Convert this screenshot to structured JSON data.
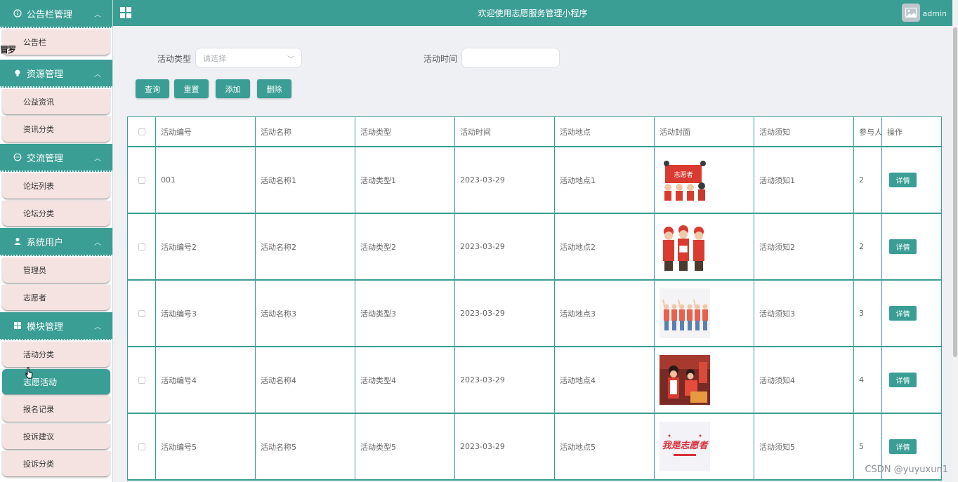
{
  "header": {
    "title": "欢迎使用志愿服务管理小程序",
    "username": "admin"
  },
  "stray_text": "冒罗",
  "sidebar": {
    "groups": [
      {
        "label": "公告栏管理",
        "icon": "info-circle-icon",
        "items": [
          {
            "label": "公告栏"
          }
        ]
      },
      {
        "label": "资源管理",
        "icon": "lightbulb-icon",
        "items": [
          {
            "label": "公益资讯"
          },
          {
            "label": "资讯分类"
          }
        ]
      },
      {
        "label": "交流管理",
        "icon": "chat-bubble-icon",
        "items": [
          {
            "label": "论坛列表"
          },
          {
            "label": "论坛分类"
          }
        ]
      },
      {
        "label": "系统用户",
        "icon": "user-icon",
        "items": [
          {
            "label": "管理员"
          },
          {
            "label": "志愿者"
          }
        ]
      },
      {
        "label": "模块管理",
        "icon": "grid-icon",
        "items": [
          {
            "label": "活动分类"
          },
          {
            "label": "志愿活动",
            "active": true
          },
          {
            "label": "报名记录"
          },
          {
            "label": "投诉建议"
          },
          {
            "label": "投诉分类"
          }
        ]
      }
    ]
  },
  "search": {
    "type_label": "活动类型",
    "type_placeholder": "请选择",
    "time_label": "活动时间",
    "time_value": ""
  },
  "buttons": {
    "query": "查询",
    "reset": "重置",
    "add": "添加",
    "delete": "删除"
  },
  "table": {
    "columns": [
      "活动编号",
      "活动名称",
      "活动类型",
      "活动时间",
      "活动地点",
      "活动封面",
      "活动须知",
      "参与人数",
      "操作"
    ],
    "detail_label": "详情",
    "rows": [
      {
        "id": "001",
        "name": "活动名称1",
        "type": "活动类型1",
        "time": "2023-03-29",
        "place": "活动地点1",
        "notice": "活动须知1",
        "count": "2"
      },
      {
        "id": "活动编号2",
        "name": "活动名称2",
        "type": "活动类型2",
        "time": "2023-03-29",
        "place": "活动地点2",
        "notice": "活动须知2",
        "count": "2"
      },
      {
        "id": "活动编号3",
        "name": "活动名称3",
        "type": "活动类型3",
        "time": "2023-03-29",
        "place": "活动地点3",
        "notice": "活动须知3",
        "count": "3"
      },
      {
        "id": "活动编号4",
        "name": "活动名称4",
        "type": "活动类型4",
        "time": "2023-03-29",
        "place": "活动地点4",
        "notice": "活动须知4",
        "count": "4"
      },
      {
        "id": "活动编号5",
        "name": "活动名称5",
        "type": "活动类型5",
        "time": "2023-03-29",
        "place": "活动地点5",
        "notice": "活动须知5",
        "count": "5"
      }
    ]
  },
  "cover_texts": {
    "row1_banner": "志愿者",
    "row5_slogan": "我是志愿者"
  },
  "watermark": "CSDN @yuyuxun1",
  "colors": {
    "primary": "#3a9e95",
    "menu_item_bg": "#f5e3e1",
    "page_bg": "#eef0f4"
  }
}
